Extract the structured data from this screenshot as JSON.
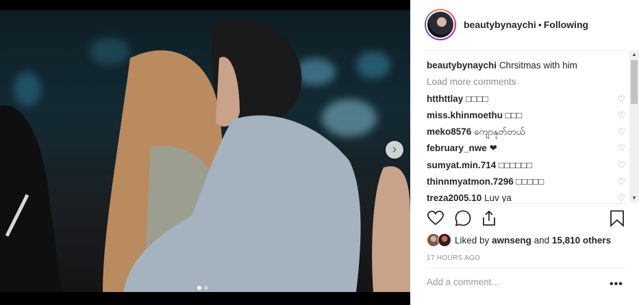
{
  "post": {
    "author": "beautybynaychi",
    "follow_status": "Following",
    "separator": "•"
  },
  "caption": {
    "user": "beautybynaychi",
    "text": "Chrsitmas with him"
  },
  "load_more": "Load more comments",
  "comments": [
    {
      "user": "htthttlay",
      "text": "□□□□"
    },
    {
      "user": "miss.khinmoethu",
      "text": "□□□"
    },
    {
      "user": "meko8576",
      "text": "ကျောနုတ်တယ်"
    },
    {
      "user": "february_nwe",
      "text": "❤"
    },
    {
      "user": "sumyat.min.714",
      "text": "□□□□□□"
    },
    {
      "user": "thinnmyatmon.7296",
      "text": "□□□□□"
    },
    {
      "user": "treza2005.10",
      "text": "Luv ya"
    }
  ],
  "likes": {
    "prefix": "Liked by",
    "user": "awnseng",
    "conjunction": "and",
    "count_text": "15,810 others"
  },
  "timestamp": "17 HOURS AGO",
  "add_comment_placeholder": "Add a comment...",
  "more_options": "•••",
  "icons": {
    "like": "heart-icon",
    "comment": "comment-icon",
    "share": "share-icon",
    "save": "bookmark-icon",
    "next": "chevron-right-icon"
  },
  "carousel": {
    "count": 2,
    "active": 1
  },
  "colors": {
    "text": "#262626",
    "muted": "#8e8e8e",
    "divider": "#efefef"
  }
}
